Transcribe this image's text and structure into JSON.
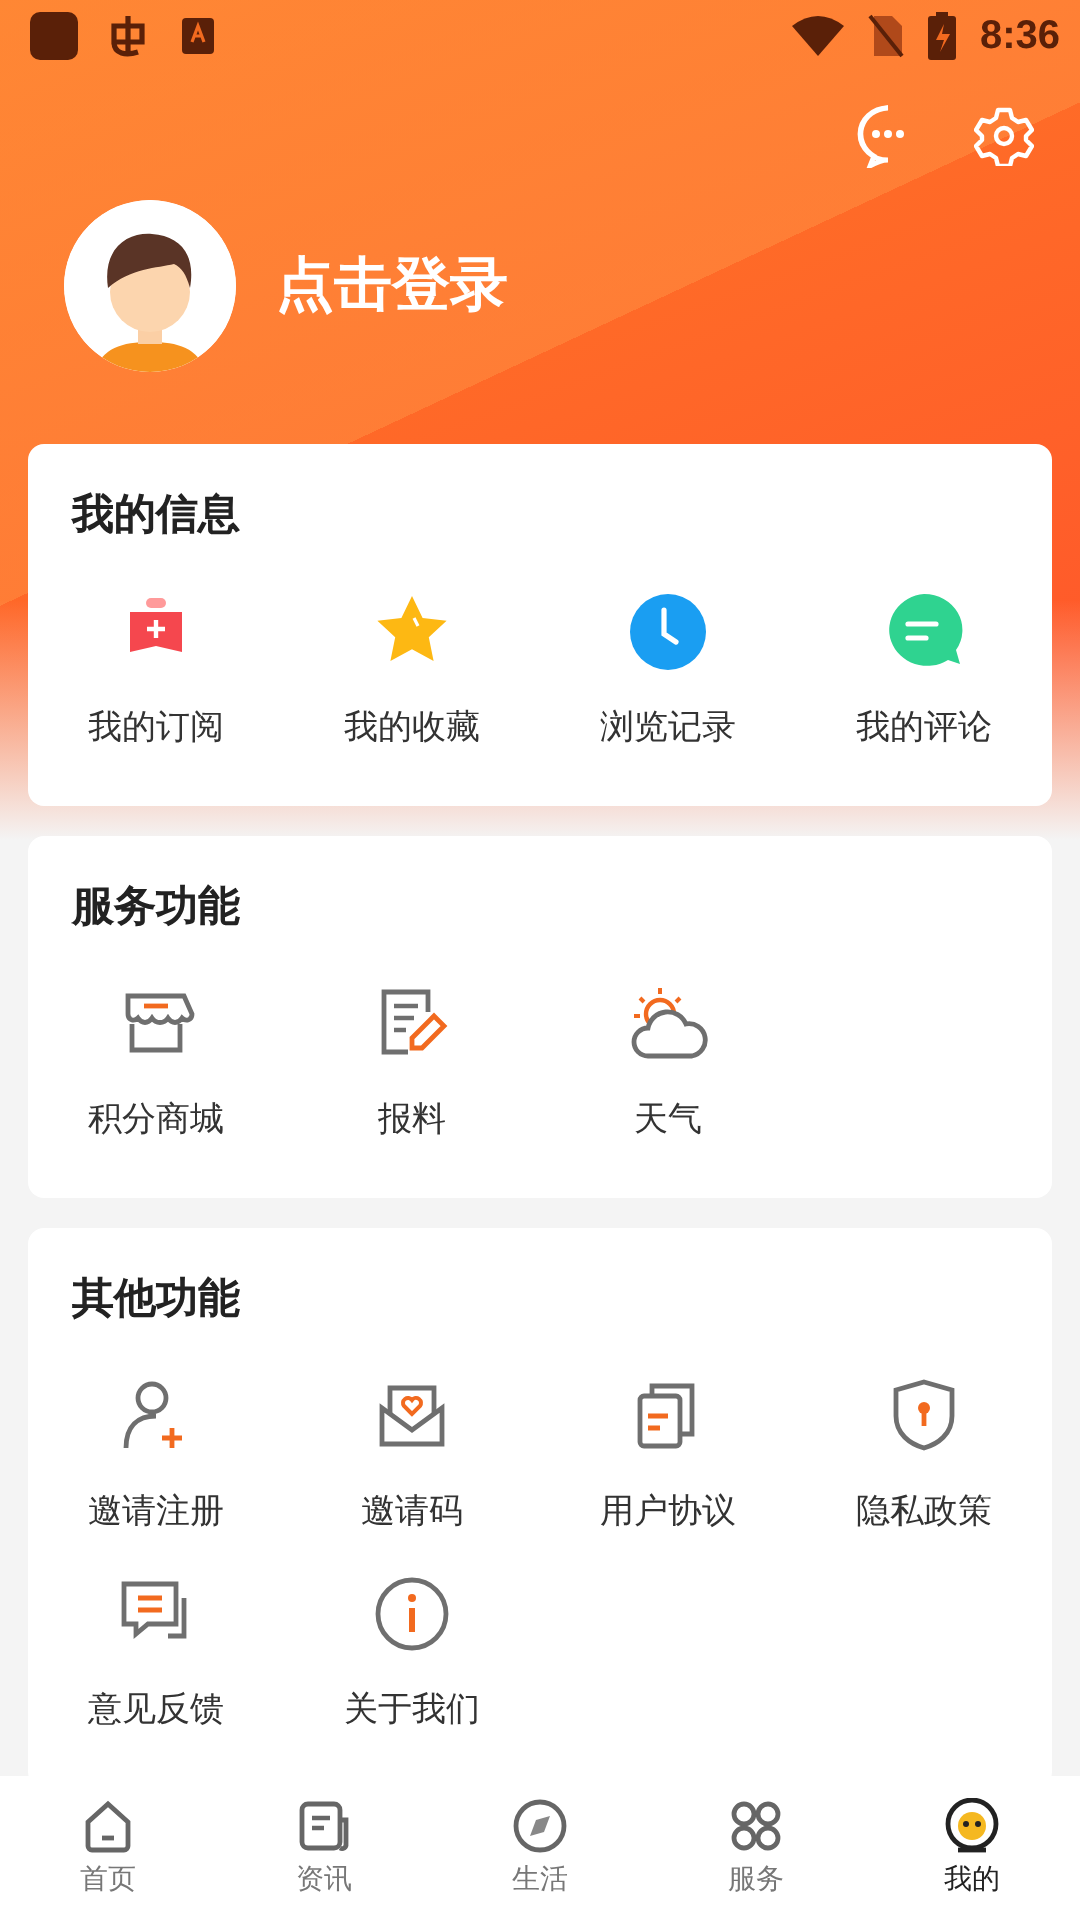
{
  "status_bar": {
    "time": "8:36"
  },
  "profile": {
    "login_label": "点击登录"
  },
  "sections": [
    {
      "title": "我的信息",
      "items": [
        {
          "label": "我的订阅"
        },
        {
          "label": "我的收藏"
        },
        {
          "label": "浏览记录"
        },
        {
          "label": "我的评论"
        }
      ]
    },
    {
      "title": "服务功能",
      "items": [
        {
          "label": "积分商城"
        },
        {
          "label": "报料"
        },
        {
          "label": "天气"
        }
      ]
    },
    {
      "title": "其他功能",
      "items": [
        {
          "label": "邀请注册"
        },
        {
          "label": "邀请码"
        },
        {
          "label": "用户协议"
        },
        {
          "label": "隐私政策"
        },
        {
          "label": "意见反馈"
        },
        {
          "label": "关于我们"
        }
      ]
    }
  ],
  "bottom_nav": [
    {
      "label": "首页",
      "selected": false
    },
    {
      "label": "资讯",
      "selected": false
    },
    {
      "label": "生活",
      "selected": false
    },
    {
      "label": "服务",
      "selected": false
    },
    {
      "label": "我的",
      "selected": true
    }
  ]
}
